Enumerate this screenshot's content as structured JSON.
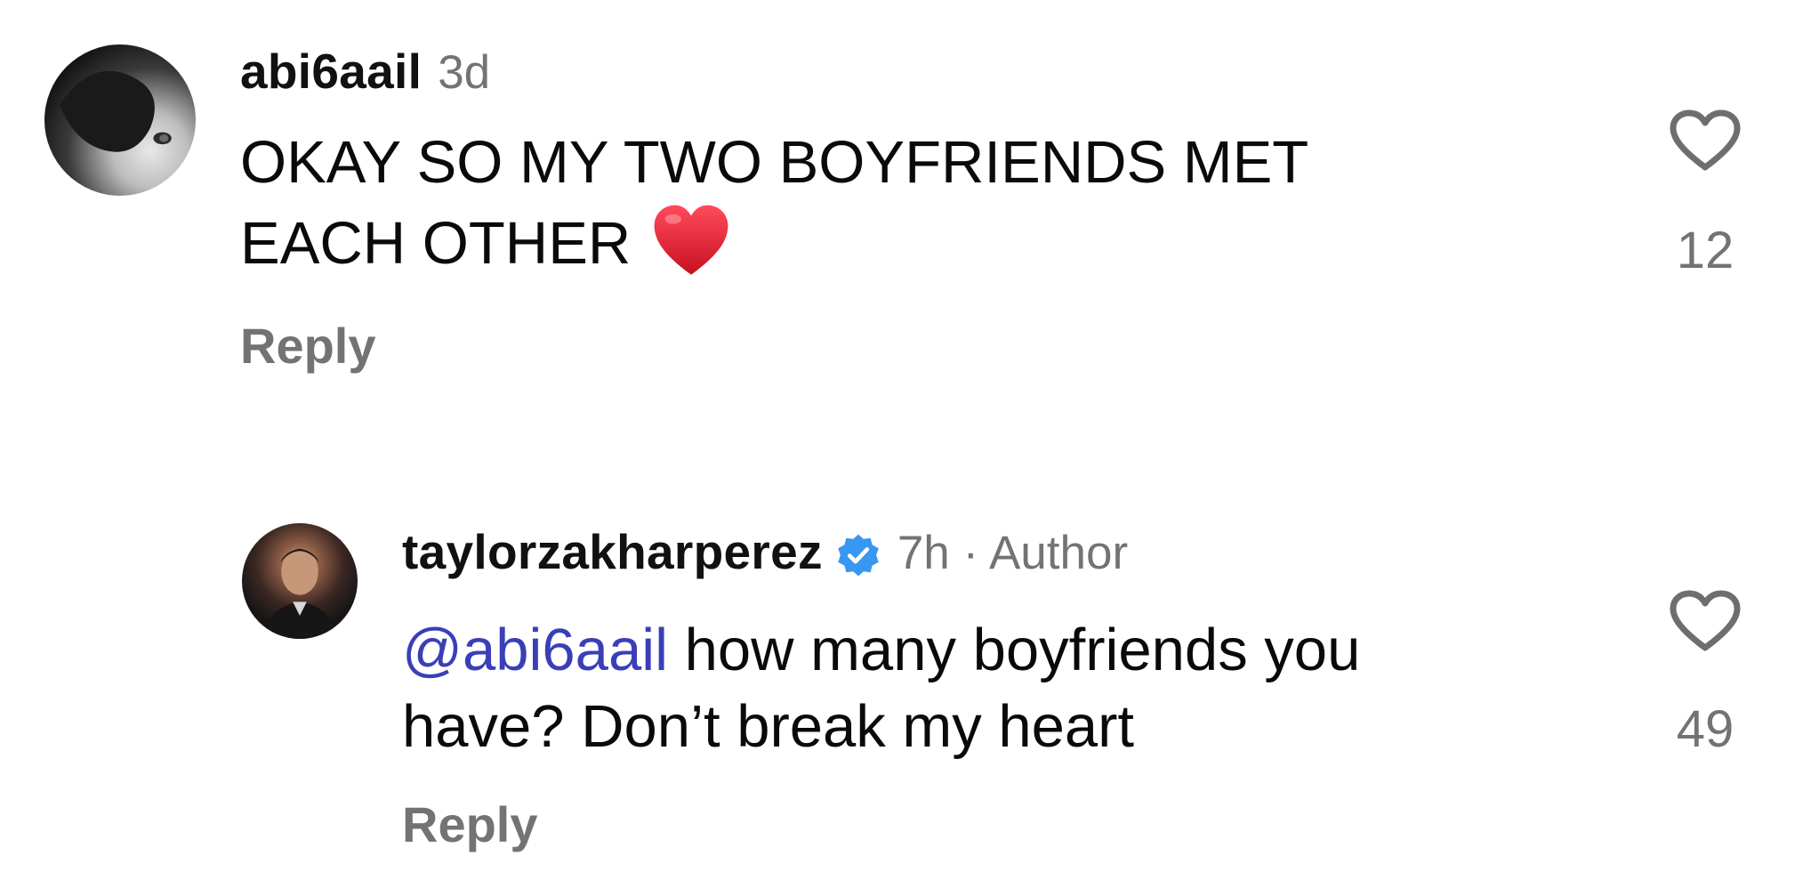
{
  "comments": [
    {
      "avatar_icon": "avatar-image",
      "username": "abi6aail",
      "timestamp": "3d",
      "text_line1": "OKAY SO MY TWO BOYFRIENDS MET",
      "text_line2": "EACH OTHER",
      "emoji": "red-heart-emoji",
      "reply_label": "Reply",
      "like_icon": "heart-outline-icon",
      "like_count": "12"
    },
    {
      "avatar_icon": "avatar-image",
      "username": "taylorzakharperez",
      "verified_icon": "verified-badge-icon",
      "timestamp": "7h · Author",
      "mention": "@abi6aail",
      "text_line1_rest": " how many boyfriends you",
      "text_line2": "have? Don’t break my heart",
      "reply_label": "Reply",
      "like_icon": "heart-outline-icon",
      "like_count": "49"
    }
  ],
  "colors": {
    "username": "#111111",
    "secondary_text": "#737373",
    "mention": "#3a3fb8",
    "verified": "#3897f0",
    "emoji_heart": "#e0192b"
  }
}
